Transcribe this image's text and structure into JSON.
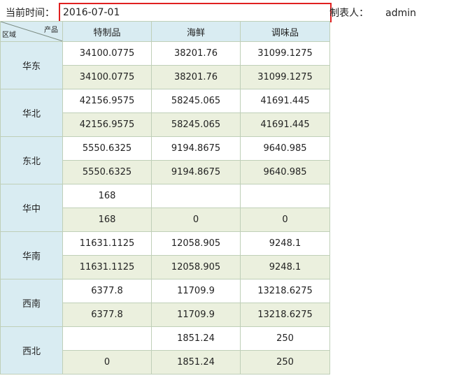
{
  "header": {
    "time_label": "当前时间：",
    "date_value": "2016-07-01",
    "maker_label": "制表人：",
    "maker_value": "admin"
  },
  "table": {
    "corner_product": "产品",
    "corner_region": "区域",
    "columns": [
      "特制品",
      "海鲜",
      "调味品"
    ],
    "regions": [
      {
        "name": "华东",
        "rows": [
          [
            "34100.0775",
            "38201.76",
            "31099.1275"
          ],
          [
            "34100.0775",
            "38201.76",
            "31099.1275"
          ]
        ]
      },
      {
        "name": "华北",
        "rows": [
          [
            "42156.9575",
            "58245.065",
            "41691.445"
          ],
          [
            "42156.9575",
            "58245.065",
            "41691.445"
          ]
        ]
      },
      {
        "name": "东北",
        "rows": [
          [
            "5550.6325",
            "9194.8675",
            "9640.985"
          ],
          [
            "5550.6325",
            "9194.8675",
            "9640.985"
          ]
        ]
      },
      {
        "name": "华中",
        "rows": [
          [
            "168",
            "",
            ""
          ],
          [
            "168",
            "0",
            "0"
          ]
        ]
      },
      {
        "name": "华南",
        "rows": [
          [
            "11631.1125",
            "12058.905",
            "9248.1"
          ],
          [
            "11631.1125",
            "12058.905",
            "9248.1"
          ]
        ]
      },
      {
        "name": "西南",
        "rows": [
          [
            "6377.8",
            "11709.9",
            "13218.6275"
          ],
          [
            "6377.8",
            "11709.9",
            "13218.6275"
          ]
        ]
      },
      {
        "name": "西北",
        "rows": [
          [
            "",
            "1851.24",
            "250"
          ],
          [
            "0",
            "1851.24",
            "250"
          ]
        ]
      }
    ]
  }
}
